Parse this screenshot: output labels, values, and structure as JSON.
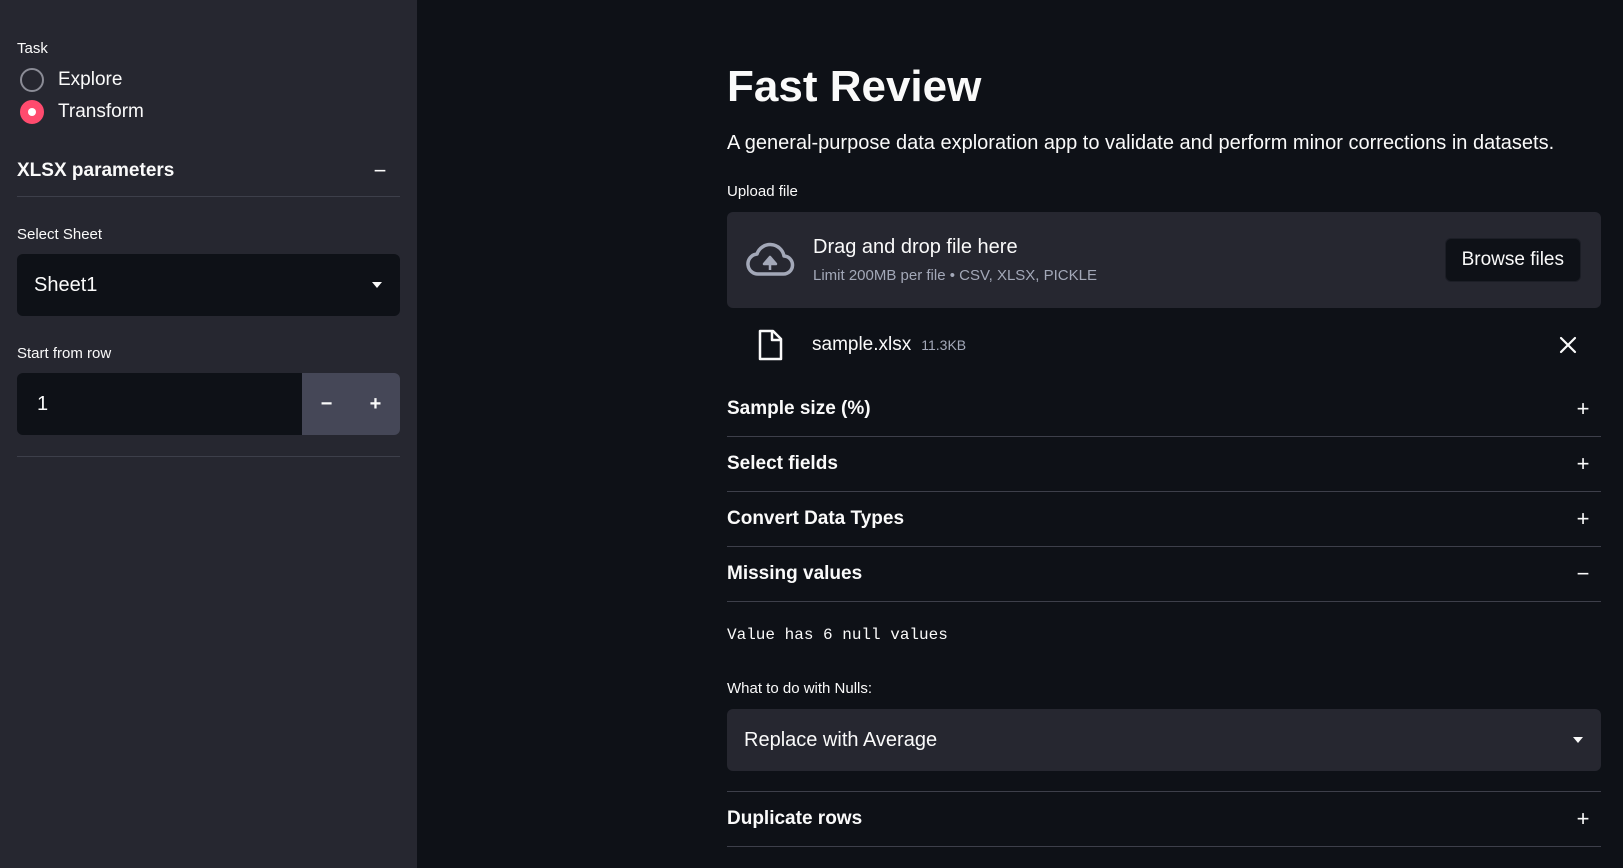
{
  "sidebar": {
    "task_label": "Task",
    "task_options": [
      {
        "label": "Explore",
        "checked": false
      },
      {
        "label": "Transform",
        "checked": true
      }
    ],
    "xlsx_params": {
      "title": "XLSX parameters",
      "toggle": "−",
      "select_sheet_label": "Select Sheet",
      "select_sheet_value": "Sheet1",
      "start_row_label": "Start from row",
      "start_row_value": "1",
      "minus": "−",
      "plus": "+"
    }
  },
  "main": {
    "title": "Fast Review",
    "subtitle": "A general-purpose data exploration app to validate and perform minor corrections in datasets.",
    "upload": {
      "label": "Upload file",
      "drag_text": "Drag and drop file here",
      "limit_text": "Limit 200MB per file • CSV, XLSX, PICKLE",
      "browse_label": "Browse files",
      "file_name": "sample.xlsx",
      "file_size": "11.3KB"
    },
    "expanders": [
      {
        "title": "Sample size (%)",
        "toggle": "+"
      },
      {
        "title": "Select fields",
        "toggle": "+"
      },
      {
        "title": "Convert Data Types",
        "toggle": "+"
      },
      {
        "title": "Missing values",
        "toggle": "−"
      },
      {
        "title": "Duplicate rows",
        "toggle": "+"
      }
    ],
    "missing_values": {
      "null_info": "Value has 6 null values",
      "nulls_label": "What to do with Nulls:",
      "nulls_value": "Replace with Average"
    }
  },
  "colors": {
    "accent": "#ff4b6e",
    "sidebar_bg": "#262730",
    "main_bg": "#0e1117"
  }
}
